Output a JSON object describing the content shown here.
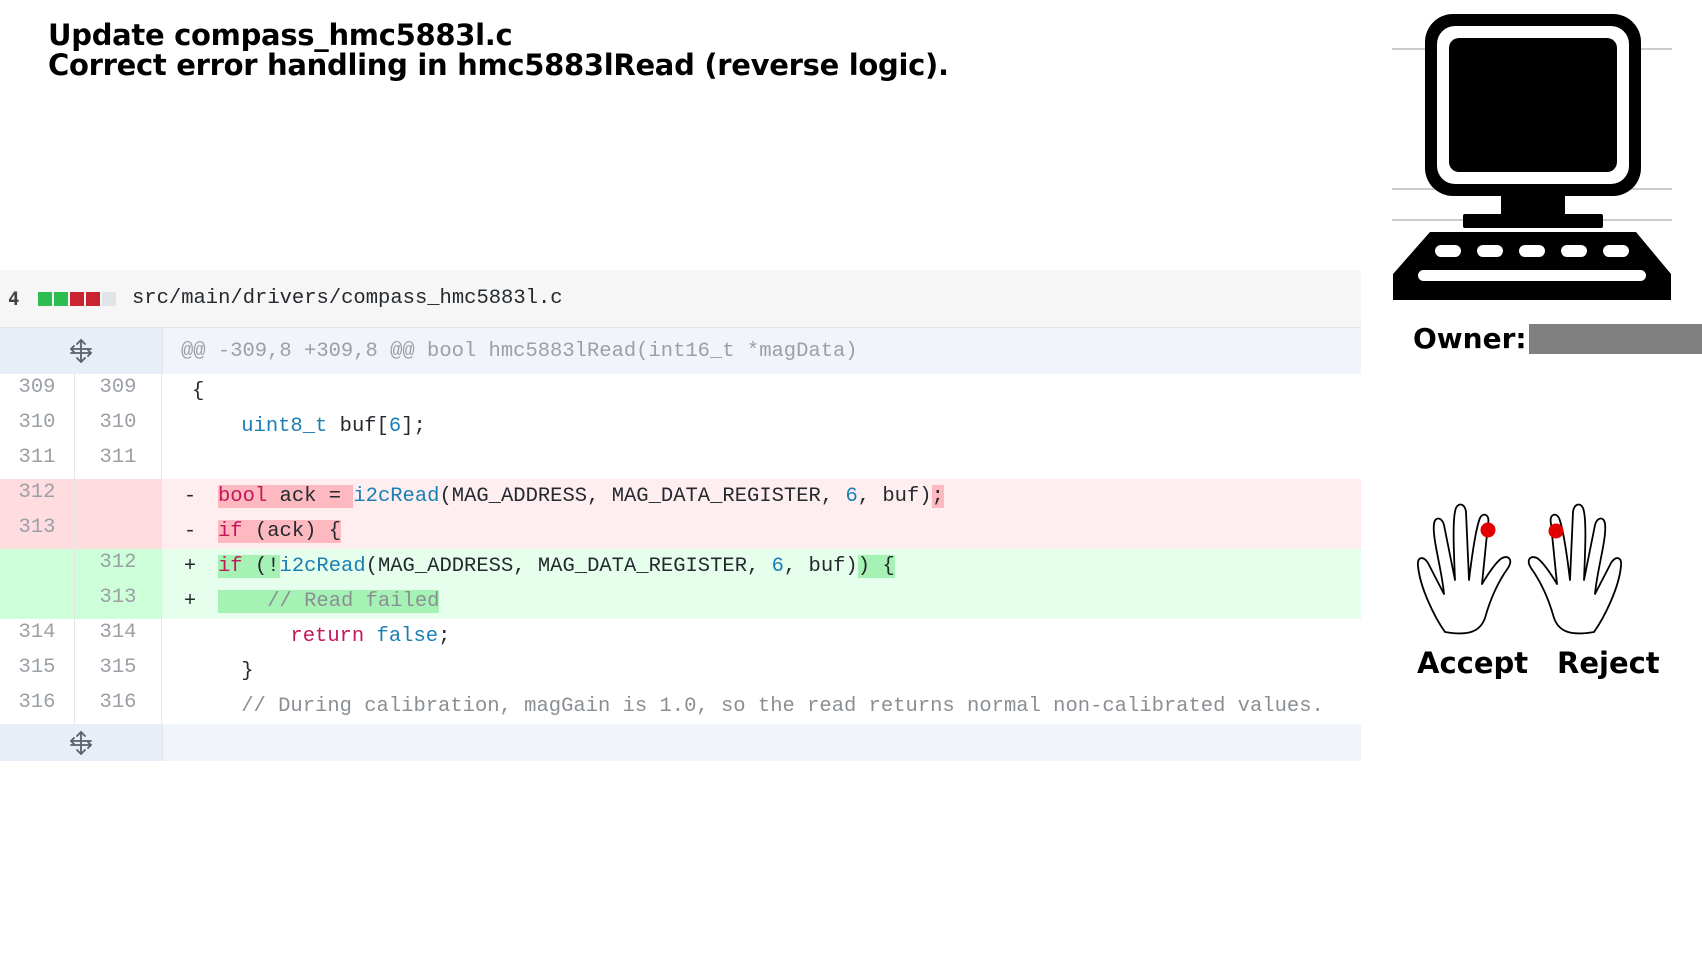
{
  "title": {
    "line1": "Update compass_hmc5883l.c",
    "line2": "Correct error handling in hmc5883lRead (reverse logic)."
  },
  "file": {
    "changes": "4",
    "path": "src/main/drivers/compass_hmc5883l.c",
    "diffstat_colors": [
      "#2cbe4e",
      "#2cbe4e",
      "#cb2431",
      "#cb2431",
      "#e1e4e8"
    ]
  },
  "hunk": {
    "header": "@@ -309,8 +309,8 @@ bool hmc5883lRead(int16_t *magData)",
    "icon": "unfold-icon"
  },
  "lines": [
    {
      "old": "309",
      "new": "309"
    },
    {
      "old": "310",
      "new": "310"
    },
    {
      "old": "311",
      "new": "311"
    },
    {
      "old": "312",
      "new": "",
      "marker": "-"
    },
    {
      "old": "313",
      "new": "",
      "marker": "-"
    },
    {
      "old": "",
      "new": "312",
      "marker": "+"
    },
    {
      "old": "",
      "new": "313",
      "marker": "+"
    },
    {
      "old": "314",
      "new": "314"
    },
    {
      "old": "315",
      "new": "315"
    },
    {
      "old": "316",
      "new": "316"
    }
  ],
  "code": {
    "l309": "{",
    "l310_type": "uint8_t",
    "l310_rest": " buf[",
    "l310_num": "6",
    "l310_end": "];",
    "d312_bool": "bool",
    "d312_ack": " ack = ",
    "d312_fn": "i2cRead",
    "d312_args": "(MAG_ADDRESS, MAG_DATA_REGISTER, ",
    "d312_num": "6",
    "d312_tail": ", buf)",
    "d312_semi": ";",
    "d313_if": "if",
    "d313_rest": " (ack) {",
    "a312_if": "if",
    "a312_open": " (!",
    "a312_fn": "i2cRead",
    "a312_args": "(MAG_ADDRESS, MAG_DATA_REGISTER, ",
    "a312_num": "6",
    "a312_tail": ", buf)",
    "a312_close": ") {",
    "a313_comment": "    // Read failed",
    "l314_kw": "return",
    "l314_sp": " ",
    "l314_val": "false",
    "l314_semi": ";",
    "l315": "}",
    "l316": "// During calibration, magGain is 1.0, so the read returns normal non-calibrated values."
  },
  "sidebar": {
    "owner_label": "Owner:",
    "accept_label": "Accept",
    "reject_label": "Reject",
    "computer_icon": "computer-icon",
    "hands_icon": "hands-icon",
    "marker_color": "#e00000"
  }
}
